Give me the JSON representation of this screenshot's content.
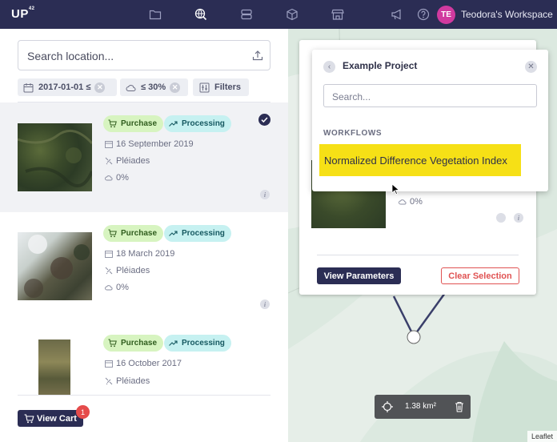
{
  "app": {
    "logo": "UP",
    "logo_sup": "42",
    "workspace": "Teodora's Workspace",
    "avatar_initials": "TE"
  },
  "nav_icons": [
    "folder-icon",
    "globe-search-icon",
    "database-icon",
    "cube-icon",
    "store-icon",
    "megaphone-icon",
    "help-icon"
  ],
  "search": {
    "placeholder": "Search location..."
  },
  "filters": {
    "date_chip": "2017-01-01 ≤",
    "cloud_chip": "≤ 30%",
    "filters_label": "Filters"
  },
  "results": [
    {
      "purchase": "Purchase",
      "processing": "Processing",
      "date": "16 September 2019",
      "sensor": "Pléiades",
      "cloud": "0%",
      "selected": true
    },
    {
      "purchase": "Purchase",
      "processing": "Processing",
      "date": "18 March 2019",
      "sensor": "Pléiades",
      "cloud": "0%",
      "selected": false
    },
    {
      "purchase": "Purchase",
      "processing": "Processing",
      "date": "16 October 2017",
      "sensor": "Pléiades",
      "cloud": "",
      "selected": false
    }
  ],
  "cart": {
    "label": "View Cart",
    "count": "1"
  },
  "card": {
    "cloud": "0%",
    "view_params": "View Parameters",
    "clear": "Clear Selection"
  },
  "dropdown": {
    "title": "Example Project",
    "search_placeholder": "Search...",
    "section": "WORKFLOWS",
    "option": "Normalized Difference Vegetation Index"
  },
  "map": {
    "area": "1.38 km²",
    "attribution": "Leaflet"
  },
  "colors": {
    "nav": "#2b2d54",
    "accent_yellow": "#f6e016",
    "danger": "#e05353",
    "avatar": "#d13a9f"
  }
}
